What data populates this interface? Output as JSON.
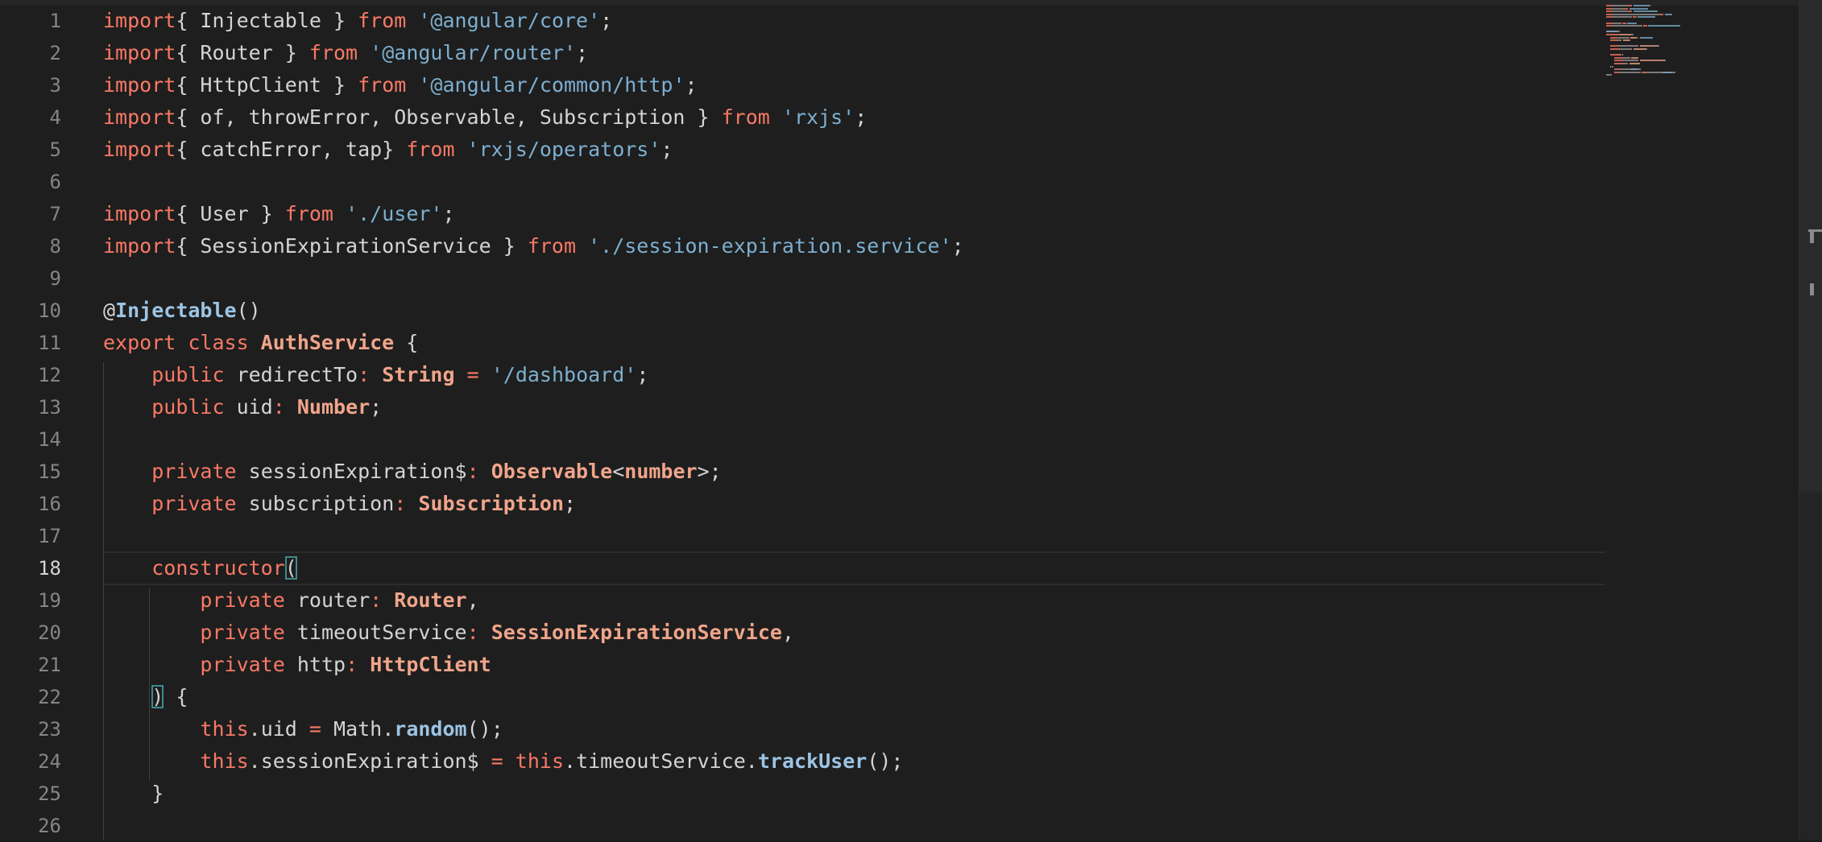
{
  "editor": {
    "active_line": 18,
    "lines": [
      {
        "n": "1",
        "tokens": [
          [
            "kw",
            "import"
          ],
          [
            "",
            "{ Injectable } "
          ],
          [
            "kw",
            "from"
          ],
          [
            "",
            " "
          ],
          [
            "str",
            "'@angular/core'"
          ],
          [
            "",
            ";"
          ]
        ]
      },
      {
        "n": "2",
        "tokens": [
          [
            "kw",
            "import"
          ],
          [
            "",
            "{ Router } "
          ],
          [
            "kw",
            "from"
          ],
          [
            "",
            " "
          ],
          [
            "str",
            "'@angular/router'"
          ],
          [
            "",
            ";"
          ]
        ]
      },
      {
        "n": "3",
        "tokens": [
          [
            "kw",
            "import"
          ],
          [
            "",
            "{ HttpClient } "
          ],
          [
            "kw",
            "from"
          ],
          [
            "",
            " "
          ],
          [
            "str",
            "'@angular/common/http'"
          ],
          [
            "",
            ";"
          ]
        ]
      },
      {
        "n": "4",
        "tokens": [
          [
            "kw",
            "import"
          ],
          [
            "",
            "{ of, throwError, Observable, Subscription } "
          ],
          [
            "kw",
            "from"
          ],
          [
            "",
            " "
          ],
          [
            "str",
            "'rxjs'"
          ],
          [
            "",
            ";"
          ]
        ]
      },
      {
        "n": "5",
        "tokens": [
          [
            "kw",
            "import"
          ],
          [
            "",
            "{ catchError, tap} "
          ],
          [
            "kw",
            "from"
          ],
          [
            "",
            " "
          ],
          [
            "str",
            "'rxjs/operators'"
          ],
          [
            "",
            ";"
          ]
        ]
      },
      {
        "n": "6",
        "tokens": []
      },
      {
        "n": "7",
        "tokens": [
          [
            "kw",
            "import"
          ],
          [
            "",
            "{ User } "
          ],
          [
            "kw",
            "from"
          ],
          [
            "",
            " "
          ],
          [
            "str",
            "'./user'"
          ],
          [
            "",
            ";"
          ]
        ]
      },
      {
        "n": "8",
        "tokens": [
          [
            "kw",
            "import"
          ],
          [
            "",
            "{ SessionExpirationService } "
          ],
          [
            "kw",
            "from"
          ],
          [
            "",
            " "
          ],
          [
            "str",
            "'./session-expiration.service'"
          ],
          [
            "",
            ";"
          ]
        ]
      },
      {
        "n": "9",
        "tokens": []
      },
      {
        "n": "10",
        "tokens": [
          [
            "",
            "@"
          ],
          [
            "dec",
            "Injectable"
          ],
          [
            "",
            "()"
          ]
        ]
      },
      {
        "n": "11",
        "tokens": [
          [
            "kw",
            "export class "
          ],
          [
            "typ",
            "AuthService"
          ],
          [
            "",
            " {"
          ]
        ]
      },
      {
        "n": "12",
        "tokens": [
          [
            "",
            "    "
          ],
          [
            "kw",
            "public "
          ],
          [
            "",
            "redirectTo"
          ],
          [
            "op",
            ":"
          ],
          [
            "",
            " "
          ],
          [
            "typ",
            "String"
          ],
          [
            "",
            " "
          ],
          [
            "op",
            "="
          ],
          [
            "",
            " "
          ],
          [
            "str",
            "'/dashboard'"
          ],
          [
            "",
            ";"
          ]
        ]
      },
      {
        "n": "13",
        "tokens": [
          [
            "",
            "    "
          ],
          [
            "kw",
            "public "
          ],
          [
            "",
            "uid"
          ],
          [
            "op",
            ":"
          ],
          [
            "",
            " "
          ],
          [
            "typ",
            "Number"
          ],
          [
            "",
            ";"
          ]
        ]
      },
      {
        "n": "14",
        "tokens": []
      },
      {
        "n": "15",
        "tokens": [
          [
            "",
            "    "
          ],
          [
            "kw",
            "private "
          ],
          [
            "",
            "sessionExpiration$"
          ],
          [
            "op",
            ":"
          ],
          [
            "",
            " "
          ],
          [
            "typ",
            "Observable"
          ],
          [
            "",
            "<"
          ],
          [
            "typ",
            "number"
          ],
          [
            "",
            ">;"
          ]
        ]
      },
      {
        "n": "16",
        "tokens": [
          [
            "",
            "    "
          ],
          [
            "kw",
            "private "
          ],
          [
            "",
            "subscription"
          ],
          [
            "op",
            ":"
          ],
          [
            "",
            " "
          ],
          [
            "typ",
            "Subscription"
          ],
          [
            "",
            ";"
          ]
        ]
      },
      {
        "n": "17",
        "tokens": []
      },
      {
        "n": "18",
        "tokens": [
          [
            "",
            "    "
          ],
          [
            "ctor",
            "constructor"
          ],
          [
            "br",
            "("
          ]
        ]
      },
      {
        "n": "19",
        "tokens": [
          [
            "",
            "        "
          ],
          [
            "kw",
            "private "
          ],
          [
            "",
            "router"
          ],
          [
            "op",
            ":"
          ],
          [
            "",
            " "
          ],
          [
            "typ",
            "Router"
          ],
          [
            "",
            ","
          ]
        ]
      },
      {
        "n": "20",
        "tokens": [
          [
            "",
            "        "
          ],
          [
            "kw",
            "private "
          ],
          [
            "",
            "timeoutService"
          ],
          [
            "op",
            ":"
          ],
          [
            "",
            " "
          ],
          [
            "typ",
            "SessionExpirationService"
          ],
          [
            "",
            ","
          ]
        ]
      },
      {
        "n": "21",
        "tokens": [
          [
            "",
            "        "
          ],
          [
            "kw",
            "private "
          ],
          [
            "",
            "http"
          ],
          [
            "op",
            ":"
          ],
          [
            "",
            " "
          ],
          [
            "typ",
            "HttpClient"
          ]
        ]
      },
      {
        "n": "22",
        "tokens": [
          [
            "",
            "    "
          ],
          [
            "br",
            ")"
          ],
          [
            "",
            " {"
          ]
        ]
      },
      {
        "n": "23",
        "tokens": [
          [
            "",
            "        "
          ],
          [
            "kw",
            "this"
          ],
          [
            "",
            ".uid "
          ],
          [
            "op",
            "="
          ],
          [
            "",
            " Math."
          ],
          [
            "fn",
            "random"
          ],
          [
            "",
            "();"
          ]
        ]
      },
      {
        "n": "24",
        "tokens": [
          [
            "",
            "        "
          ],
          [
            "kw",
            "this"
          ],
          [
            "",
            ".sessionExpiration$ "
          ],
          [
            "op",
            "="
          ],
          [
            "",
            " "
          ],
          [
            "kw",
            "this"
          ],
          [
            "",
            ".timeoutService."
          ],
          [
            "fn",
            "trackUser"
          ],
          [
            "",
            "();"
          ]
        ]
      },
      {
        "n": "25",
        "tokens": [
          [
            "",
            "    }"
          ]
        ]
      },
      {
        "n": "26",
        "tokens": []
      }
    ]
  },
  "colors": {
    "background": "#1e1e1e",
    "keyword": "#f97966",
    "string": "#7dafd0",
    "type": "#f0a58a",
    "function": "#9cc4e4",
    "text": "#d4d4d4",
    "line_number": "#858585"
  }
}
